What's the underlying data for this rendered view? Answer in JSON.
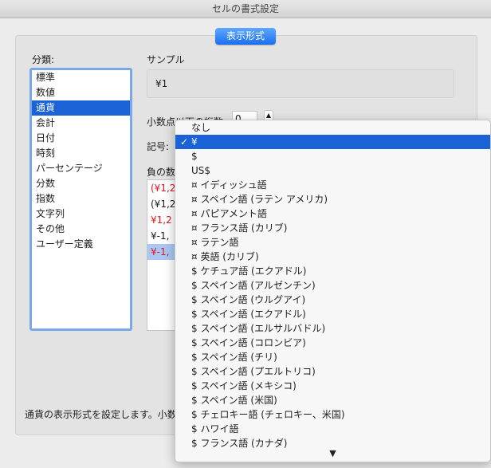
{
  "window": {
    "title": "セルの書式設定"
  },
  "tabs": [
    {
      "label": "表示形式"
    }
  ],
  "category": {
    "label": "分類:",
    "items": [
      "標準",
      "数値",
      "通貨",
      "会計",
      "日付",
      "時刻",
      "パーセンテージ",
      "分数",
      "指数",
      "文字列",
      "その他",
      "ユーザー定義"
    ],
    "selected_index": 2
  },
  "sample": {
    "label": "サンプル",
    "value": "¥1"
  },
  "decimals": {
    "label": "小数点以下の桁数:",
    "value": "0"
  },
  "symbol": {
    "label": "記号:"
  },
  "negative": {
    "label": "負の数",
    "items": [
      {
        "text": "(¥1,2",
        "color": "#e0141e"
      },
      {
        "text": "(¥1,2",
        "color": "#1d1d1d"
      },
      {
        "text": "¥1,2",
        "color": "#e0141e"
      },
      {
        "text": "¥-1,",
        "color": "#1d1d1d"
      },
      {
        "text": "¥-1,",
        "color": "#e0141e"
      }
    ],
    "selected_index": 4
  },
  "description": "通貨の表示形式を設定します。小数",
  "symbol_menu": {
    "items": [
      "なし",
      "¥",
      "$",
      "US$",
      "¤ イディッシュ語",
      "¤ スペイン語 (ラテン アメリカ)",
      "¤ パピアメント語",
      "¤ フランス語 (カリブ)",
      "¤ ラテン語",
      "¤ 英語 (カリブ)",
      "$ ケチュア語 (エクアドル)",
      "$ スペイン語 (アルゼンチン)",
      "$ スペイン語 (ウルグアイ)",
      "$ スペイン語 (エクアドル)",
      "$ スペイン語 (エルサルバドル)",
      "$ スペイン語 (コロンビア)",
      "$ スペイン語 (チリ)",
      "$ スペイン語 (プエルトリコ)",
      "$ スペイン語 (メキシコ)",
      "$ スペイン語 (米国)",
      "$ チェロキー語 (チェロキー、米国)",
      "$ ハワイ語",
      "$ フランス語 (カナダ)"
    ],
    "selected_index": 1,
    "check_glyph": "✓",
    "scroll_glyph": "▼"
  },
  "colors": {
    "accent": "#1a62d6",
    "negative_red": "#e0141e"
  }
}
